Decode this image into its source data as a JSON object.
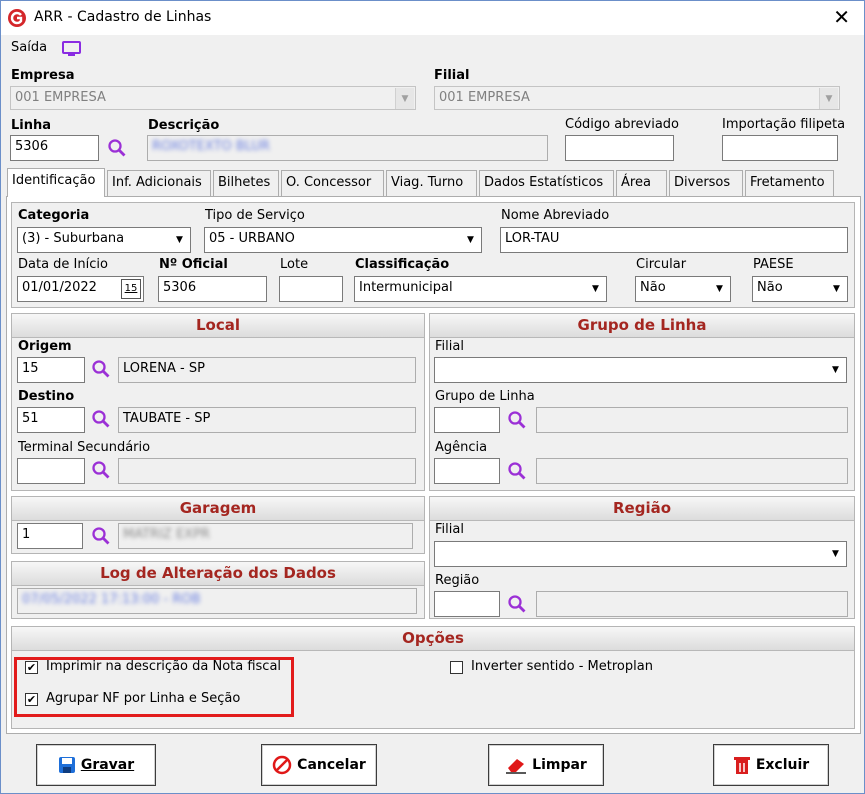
{
  "window": {
    "title": "ARR - Cadastro de Linhas",
    "close": "✕"
  },
  "menu": {
    "exit_label": "Saída"
  },
  "header": {
    "empresa_label": "Empresa",
    "empresa_value": "001 EMPRESA",
    "filial_label": "Filial",
    "filial_value": "001 EMPRESA",
    "linha_label": "Linha",
    "linha_value": "5306",
    "descricao_label": "Descrição",
    "descricao_value": "ROXOTEXTO BLUR",
    "codigo_abreviado_label": "Código abreviado",
    "importacao_label": "Importação filipeta"
  },
  "tabs": [
    "Identificação",
    "Inf. Adicionais",
    "Bilhetes",
    "O. Concessor",
    "Viag. Turno",
    "Dados Estatísticos",
    "Área",
    "Diversos",
    "Fretamento"
  ],
  "ident": {
    "categoria_label": "Categoria",
    "categoria_value": "(3) - Suburbana",
    "tipo_servico_label": "Tipo de Serviço",
    "tipo_servico_value": "05 - URBANO",
    "nome_abreviado_label": "Nome Abreviado",
    "nome_abreviado_value": "LOR-TAU",
    "data_inicio_label": "Data de Início",
    "data_inicio_value": "01/01/2022",
    "date_button": "15",
    "num_oficial_label": "Nº Oficial",
    "num_oficial_value": "5306",
    "lote_label": "Lote",
    "classificacao_label": "Classificação",
    "classificacao_value": "Intermunicipal",
    "circular_label": "Circular",
    "circular_value": "Não",
    "paese_label": "PAESE",
    "paese_value": "Não"
  },
  "local": {
    "title": "Local",
    "origem_label": "Origem",
    "origem_code": "15",
    "origem_name": "LORENA - SP",
    "destino_label": "Destino",
    "destino_code": "51",
    "destino_name": "TAUBATE - SP",
    "terminal_label": "Terminal Secundário"
  },
  "grupo": {
    "title": "Grupo de Linha",
    "filial_label": "Filial",
    "grupo_label": "Grupo de Linha",
    "agencia_label": "Agência"
  },
  "garagem": {
    "title": "Garagem",
    "code": "1",
    "name": "MATRIZ EXPR"
  },
  "log": {
    "title": "Log de Alteração dos Dados",
    "value": "07/05/2022 17:13:00 - ROB"
  },
  "regiao": {
    "title": "Região",
    "filial_label": "Filial",
    "regiao_label": "Região"
  },
  "opcoes": {
    "title": "Opções",
    "opt1": "Imprimir na descrição da Nota fiscal",
    "opt2": "Agrupar NF por Linha e Seção",
    "opt3": "Inverter sentido - Metroplan"
  },
  "buttons": {
    "gravar": "Gravar",
    "cancelar": "Cancelar",
    "limpar": "Limpar",
    "excluir": "Excluir"
  },
  "colors": {
    "group_title": "#a42620",
    "accent": "#8a2be2",
    "highlight_border": "#e21b1b"
  }
}
